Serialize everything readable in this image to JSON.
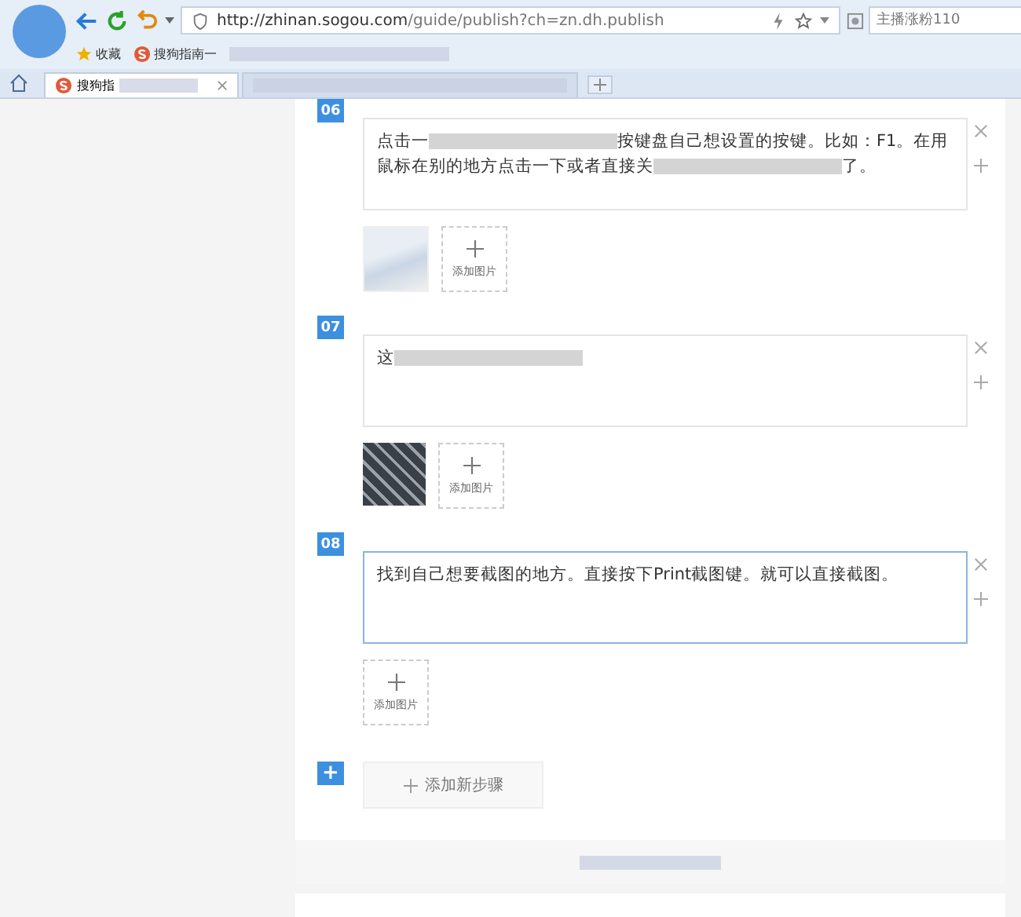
{
  "browser": {
    "url_host": "http://zhinan.sogou.com",
    "url_path": "/guide/publish?ch=zn.dh.publish",
    "search": {
      "placeholder": "主播涨粉110"
    },
    "bookmarks": [
      {
        "label": "收藏",
        "kind": "star"
      },
      {
        "label": "搜狗指南一",
        "kind": "sogou"
      }
    ],
    "tabs": [
      {
        "label": "搜狗指",
        "selected": true
      },
      {
        "selected": false
      }
    ]
  },
  "steps": [
    {
      "number": "06",
      "focused": false,
      "segments": [
        {
          "kind": "text",
          "text": "点击一"
        },
        {
          "kind": "redacted"
        },
        {
          "kind": "text",
          "text": "按键盘自己想设置的按键。比如：F1。在用鼠标在别的地方点击一下或者直接关"
        },
        {
          "kind": "redacted"
        },
        {
          "kind": "text",
          "text": "了。"
        }
      ],
      "images": [
        {
          "kind": "screenshot"
        }
      ],
      "add_image": "添加图片"
    },
    {
      "number": "07",
      "focused": false,
      "segments": [
        {
          "kind": "text",
          "text": "这"
        },
        {
          "kind": "redacted"
        }
      ],
      "images": [
        {
          "kind": "keyboard"
        }
      ],
      "add_image": "添加图片"
    },
    {
      "number": "08",
      "focused": true,
      "segments": [
        {
          "kind": "text",
          "text": "找到自己想要截图的地方。直接按下Print截图键。就可以直接截图。"
        }
      ],
      "add_image": "添加图片"
    }
  ],
  "add_step": {
    "icon": "+",
    "label": "添加新步骤"
  }
}
